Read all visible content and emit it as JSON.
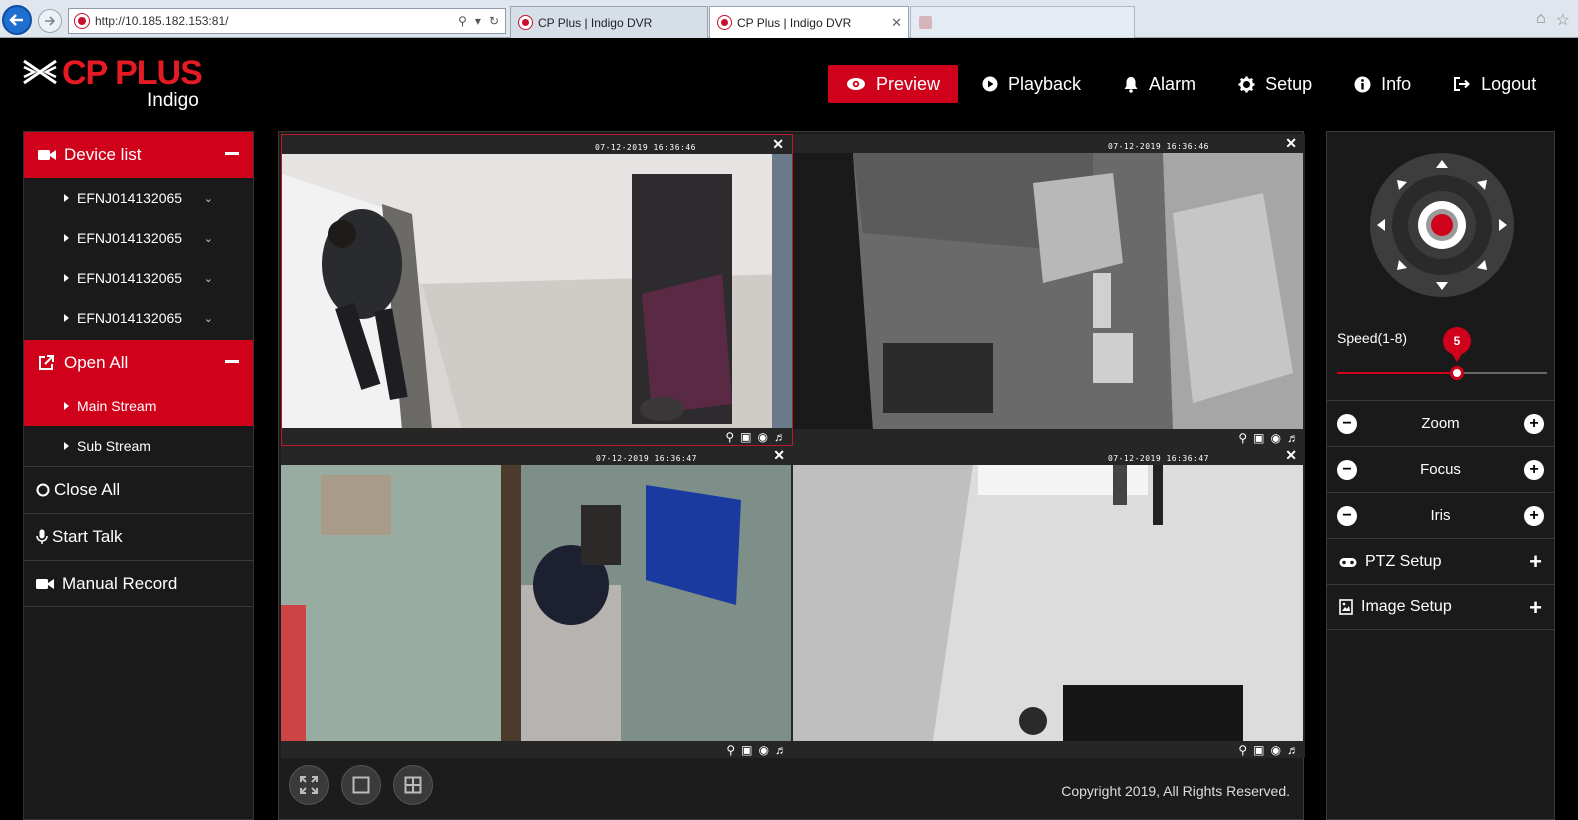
{
  "browser": {
    "url": "http://10.185.182.153:81/",
    "tabs": [
      {
        "label": "CP Plus | Indigo DVR"
      },
      {
        "label": "CP Plus | Indigo DVR"
      }
    ]
  },
  "header": {
    "brand": "CP PLUS",
    "sub_brand": "Indigo",
    "nav": [
      {
        "label": "Preview",
        "icon": "eye-icon",
        "active": true
      },
      {
        "label": "Playback",
        "icon": "play-circle-icon"
      },
      {
        "label": "Alarm",
        "icon": "bell-icon"
      },
      {
        "label": "Setup",
        "icon": "gear-icon"
      },
      {
        "label": "Info",
        "icon": "info-icon"
      },
      {
        "label": "Logout",
        "icon": "logout-icon"
      }
    ]
  },
  "sidebar": {
    "device_list_label": "Device list",
    "devices": [
      "EFNJ014132065",
      "EFNJ014132065",
      "EFNJ014132065",
      "EFNJ014132065"
    ],
    "open_all_label": "Open All",
    "streams": [
      "Main Stream",
      "Sub Stream"
    ],
    "close_all_label": "Close All",
    "start_talk_label": "Start Talk",
    "manual_record_label": "Manual Record"
  },
  "video": {
    "timestamps": [
      "07-12-2019 16:36:46",
      "07-12-2019 16:36:46",
      "07-12-2019 16:36:47",
      "07-12-2019 16:36:47"
    ],
    "copyright": "Copyright 2019, All Rights Reserved."
  },
  "ptz": {
    "speed_label": "Speed(1-8)",
    "speed_value": "5",
    "speed_fraction": 0.57,
    "controls": [
      "Zoom",
      "Focus",
      "Iris"
    ],
    "ptz_setup_label": "PTZ Setup",
    "image_setup_label": "Image Setup"
  },
  "colors": {
    "accent": "#d0021b"
  }
}
